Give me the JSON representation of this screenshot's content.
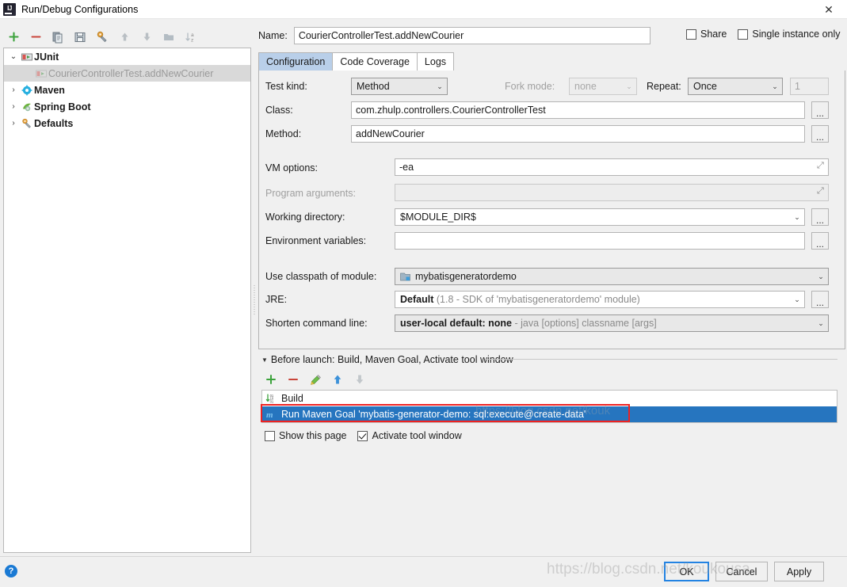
{
  "window": {
    "title": "Run/Debug Configurations",
    "close_label": "✕",
    "app_icon": "intellij-idea-icon"
  },
  "sidebar": {
    "toolbar": [
      {
        "name": "add",
        "icon": "plus-icon",
        "label": "+"
      },
      {
        "name": "remove",
        "icon": "minus-icon",
        "label": "−"
      },
      {
        "name": "copy",
        "icon": "copy-icon",
        "label": ""
      },
      {
        "name": "save",
        "icon": "save-icon",
        "label": ""
      },
      {
        "name": "edit-templates",
        "icon": "wrench-icon",
        "label": ""
      },
      {
        "name": "move-up",
        "icon": "arrow-up-icon",
        "label": ""
      },
      {
        "name": "move-down",
        "icon": "arrow-down-icon",
        "label": ""
      },
      {
        "name": "create-folder",
        "icon": "folder-icon",
        "label": ""
      },
      {
        "name": "sort-alphabetically",
        "icon": "sort-az-icon",
        "label": ""
      }
    ],
    "tree": [
      {
        "label": "JUnit",
        "icon": "junit-icon",
        "expanded": true,
        "level": 0,
        "selected": false
      },
      {
        "label": "CourierControllerTest.addNewCourier",
        "icon": "junit-run-icon",
        "level": 1,
        "selected": true
      },
      {
        "label": "Maven",
        "icon": "maven-icon",
        "expanded": false,
        "level": 0,
        "selected": false
      },
      {
        "label": "Spring Boot",
        "icon": "spring-boot-icon",
        "expanded": false,
        "level": 0,
        "selected": false
      },
      {
        "label": "Defaults",
        "icon": "defaults-icon",
        "expanded": false,
        "level": 0,
        "selected": false
      }
    ]
  },
  "header": {
    "name_label": "Name:",
    "name_value": "CourierControllerTest.addNewCourier",
    "share_label": "Share",
    "share_checked": false,
    "single_instance_label": "Single instance only",
    "single_instance_checked": false
  },
  "tabs": [
    {
      "label": "Configuration",
      "active": true
    },
    {
      "label": "Code Coverage",
      "active": false
    },
    {
      "label": "Logs",
      "active": false
    }
  ],
  "configuration": {
    "test_kind_label": "Test kind:",
    "test_kind_value": "Method",
    "fork_mode_label": "Fork mode:",
    "fork_mode_value": "none",
    "fork_mode_enabled": false,
    "repeat_label": "Repeat:",
    "repeat_value": "Once",
    "repeat_count_value": "1",
    "repeat_count_enabled": false,
    "class_label": "Class:",
    "class_value": "com.zhulp.controllers.CourierControllerTest",
    "method_label": "Method:",
    "method_value": "addNewCourier",
    "vm_options_label": "VM options:",
    "vm_options_value": "-ea",
    "program_arguments_label": "Program arguments:",
    "program_arguments_value": "",
    "program_arguments_enabled": false,
    "working_directory_label": "Working directory:",
    "working_directory_value": "$MODULE_DIR$",
    "environment_variables_label": "Environment variables:",
    "environment_variables_value": "",
    "use_classpath_label": "Use classpath of module:",
    "use_classpath_value": "mybatisgeneratordemo",
    "jre_label": "JRE:",
    "jre_value_bold": "Default",
    "jre_value_muted": "(1.8 - SDK of 'mybatisgeneratordemo' module)",
    "shorten_command_label": "Shorten command line:",
    "shorten_command_bold": "user-local default: none",
    "shorten_command_muted": "- java [options] classname [args]",
    "browse_label": "..."
  },
  "before_launch": {
    "title": "Before launch: Build, Maven Goal, Activate tool window",
    "toolbar": [
      {
        "name": "add-task",
        "icon": "plus-icon"
      },
      {
        "name": "remove-task",
        "icon": "minus-icon"
      },
      {
        "name": "edit-task",
        "icon": "pencil-icon"
      },
      {
        "name": "move-task-up",
        "icon": "arrow-up-icon"
      },
      {
        "name": "move-task-down",
        "icon": "arrow-down-icon"
      }
    ],
    "tasks": [
      {
        "label": "Build",
        "icon": "build-icon",
        "selected": false
      },
      {
        "label": "Run Maven Goal 'mybatis-generator-demo: sql:execute@create-data'",
        "icon": "maven-m-icon",
        "selected": true,
        "highlighted": true
      }
    ],
    "show_page_label": "Show this page",
    "show_page_checked": false,
    "activate_tool_window_label": "Activate tool window",
    "activate_tool_window_checked": true
  },
  "footer": {
    "help_label": "?",
    "ok_label": "OK",
    "cancel_label": "Cancel",
    "apply_label": "Apply"
  },
  "watermark": {
    "text": "https://blog.csdn.net/koukousa",
    "text2": "https://blog.csdn.net/kouk"
  },
  "colors": {
    "accent_blue": "#2675bf",
    "tab_active": "#b9cfe9",
    "highlight_red": "#ee2222",
    "focus_blue": "#2383e2",
    "dialog_bg": "#f0f0f0"
  }
}
